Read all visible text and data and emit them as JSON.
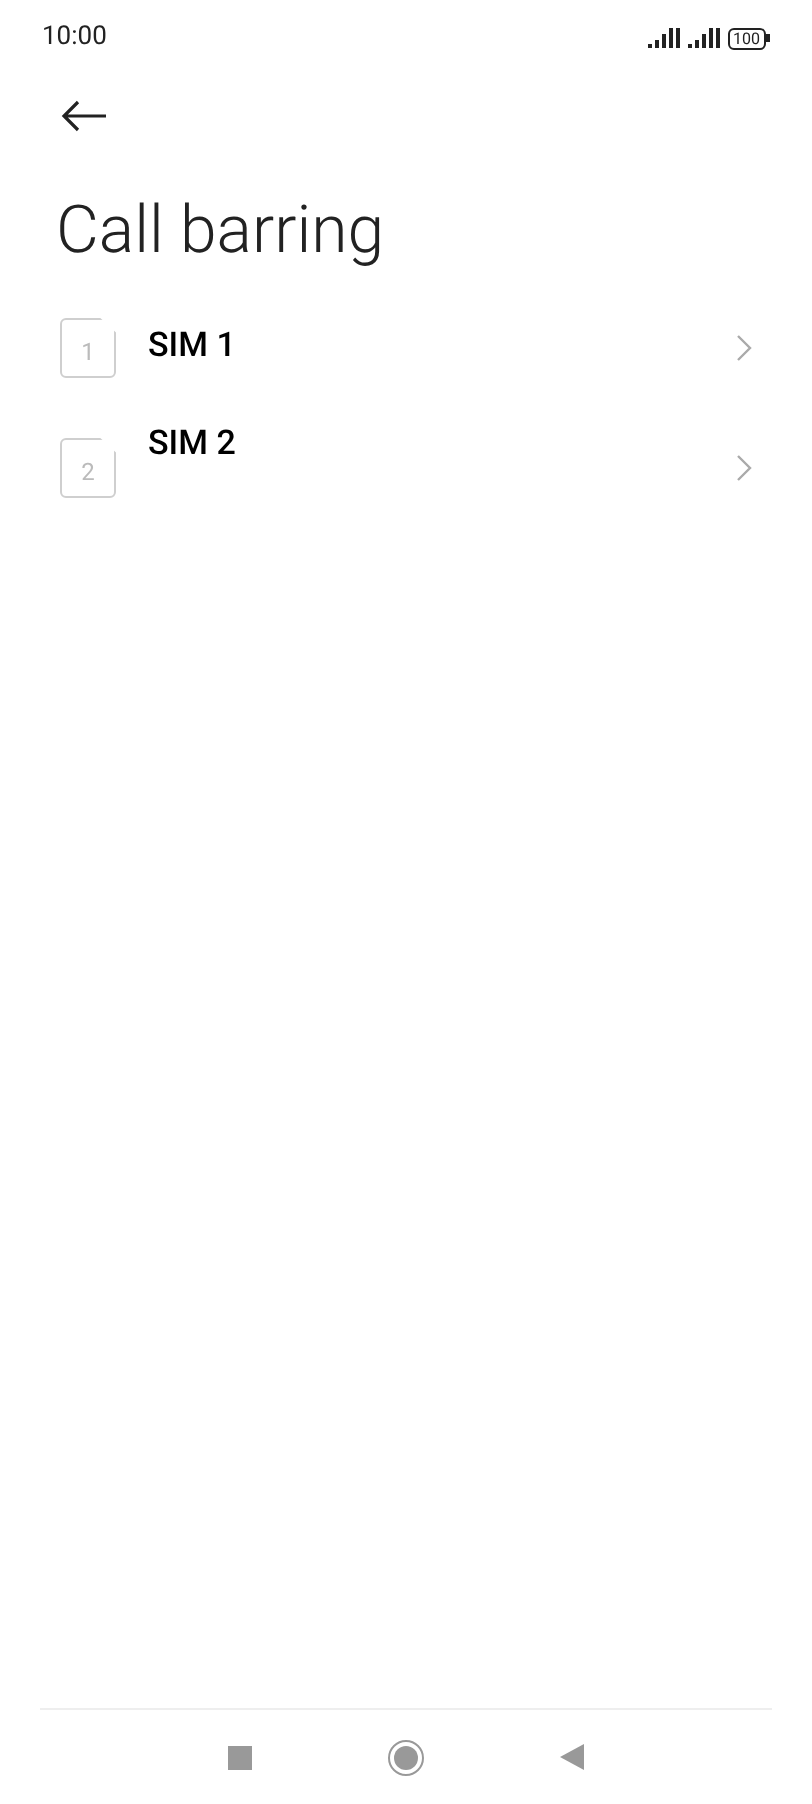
{
  "status_bar": {
    "time": "10:00",
    "battery": "100"
  },
  "title": "Call barring",
  "items": [
    {
      "sim_number": "1",
      "label": "SIM 1"
    },
    {
      "sim_number": "2",
      "label": "SIM 2"
    }
  ]
}
